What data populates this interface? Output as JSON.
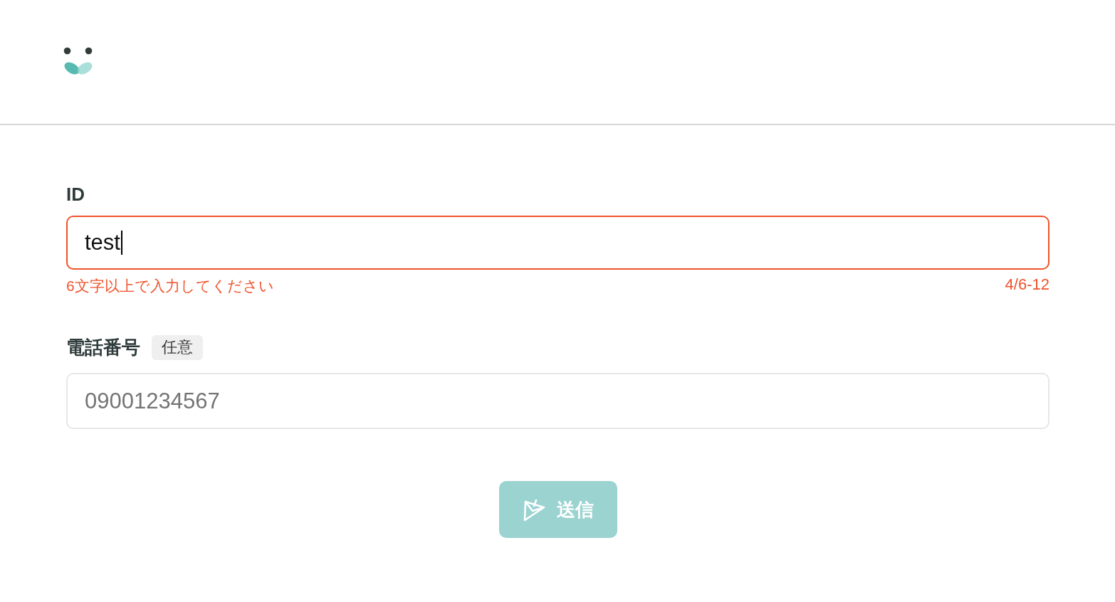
{
  "fields": [
    {
      "label": "ID",
      "value": "test",
      "focused": true,
      "invalid": true,
      "error": "6文字以上で入力してください",
      "counter": "4/6-12"
    },
    {
      "label": "電話番号",
      "badge": "任意",
      "placeholder": "09001234567",
      "focused": false,
      "invalid": false
    }
  ],
  "submit_button": {
    "label": "送信",
    "disabled": true
  }
}
